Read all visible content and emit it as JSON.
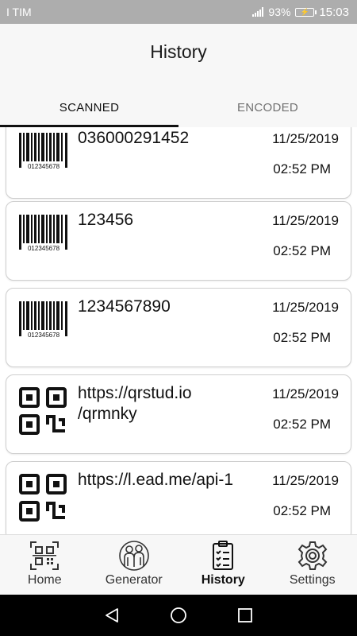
{
  "status_bar": {
    "carrier": "I TIM",
    "battery_percent": "93%",
    "time": "15:03"
  },
  "header": {
    "title": "History"
  },
  "tabs": [
    {
      "label": "SCANNED",
      "active": true
    },
    {
      "label": "ENCODED",
      "active": false
    }
  ],
  "history": [
    {
      "type": "barcode",
      "icon": "barcode-icon",
      "barcode_digits": "012345678",
      "value": "036000291452",
      "date": "11/25/2019",
      "time": "02:52 PM"
    },
    {
      "type": "barcode",
      "icon": "barcode-icon",
      "barcode_digits": "012345678",
      "value": "123456",
      "date": "11/25/2019",
      "time": "02:52 PM"
    },
    {
      "type": "barcode",
      "icon": "barcode-icon",
      "barcode_digits": "012345678",
      "value": "1234567890",
      "date": "11/25/2019",
      "time": "02:52 PM"
    },
    {
      "type": "qr",
      "icon": "qr-code-icon",
      "value": "https://qrstud.io\n/qrmnky",
      "date": "11/25/2019",
      "time": "02:52 PM"
    },
    {
      "type": "qr",
      "icon": "qr-code-icon",
      "value": "https://l.ead.me/api-1",
      "date": "11/25/2019",
      "time": "02:52 PM"
    }
  ],
  "bottom_nav": [
    {
      "label": "Home",
      "icon": "qr-scan-icon",
      "active": false
    },
    {
      "label": "Generator",
      "icon": "people-icon",
      "active": false
    },
    {
      "label": "History",
      "icon": "clipboard-checklist-icon",
      "active": true
    },
    {
      "label": "Settings",
      "icon": "gear-icon",
      "active": false
    }
  ],
  "system_nav": {
    "back": "back-icon",
    "home": "home-circle-icon",
    "recents": "recents-square-icon"
  },
  "colors": {
    "status_bar": "#adadad",
    "app_bar": "#f7f7f7",
    "card_border": "#cfcfcf",
    "system_nav": "#000000"
  }
}
